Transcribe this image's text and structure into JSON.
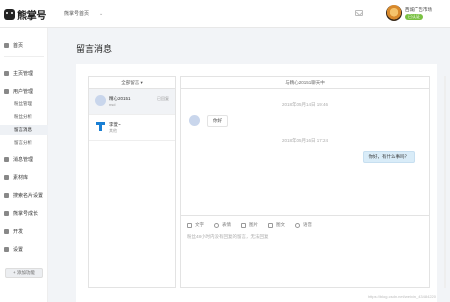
{
  "app": {
    "logo_text": "熊掌号",
    "breadcrumb": "熊掌号首页",
    "user_name": "西城广告市场",
    "user_badge": "已认证"
  },
  "sidebar": {
    "items": [
      {
        "label": "首页"
      },
      {
        "label": "主页管理"
      },
      {
        "label": "用户管理"
      },
      {
        "label": "粉丝管理"
      },
      {
        "label": "粉丝分析"
      },
      {
        "label": "留言消息"
      },
      {
        "label": "留言分析"
      },
      {
        "label": "消息管理"
      },
      {
        "label": "素材库"
      },
      {
        "label": "搜索名片设置"
      },
      {
        "label": "熊掌号成长"
      },
      {
        "label": "开发"
      },
      {
        "label": "设置"
      }
    ],
    "add_button": "+ 添加功能"
  },
  "main": {
    "title": "留言消息"
  },
  "conversations": {
    "filter": "全部留言 ▾",
    "items": [
      {
        "name": "精心20151",
        "sub": "nsd",
        "status": "已回复"
      },
      {
        "name": "李萱~",
        "sub": "其他",
        "status": ""
      }
    ]
  },
  "chat": {
    "header": "与精心20151聊天中",
    "time_1": "2018年05月14日 19:46",
    "msg_in": "你好",
    "time_2": "2018年05月16日 17:24",
    "msg_out": "你好，有什么事吗？",
    "tools": [
      "文字",
      "表情",
      "图片",
      "图文",
      "语音"
    ],
    "hint": "粉丝48小时内没有回复的留言，无法回复"
  },
  "watermark": "https://blog.csdn.net/weixin_43484220"
}
